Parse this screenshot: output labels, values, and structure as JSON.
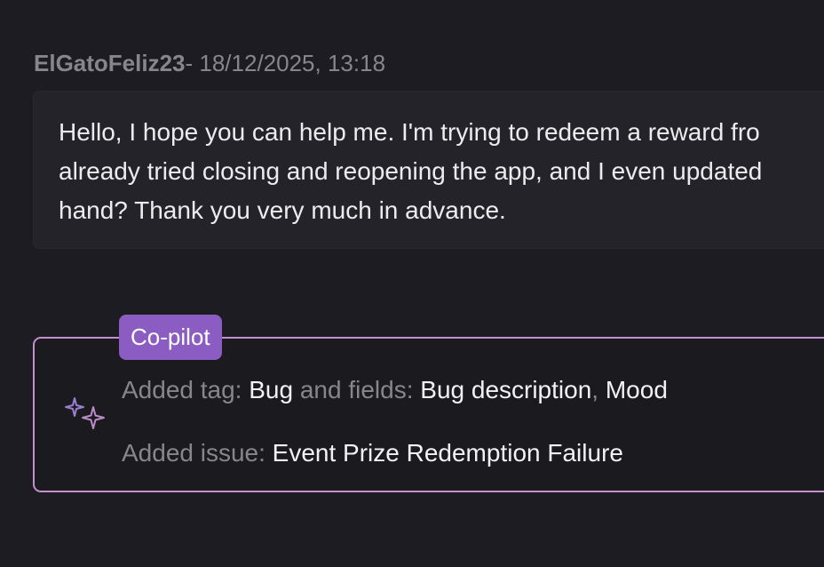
{
  "message": {
    "author": "ElGatoFeliz23",
    "separator": "- ",
    "timestamp": "18/12/2025, 13:18",
    "lines": [
      "Hello, I hope you can help me. I'm trying to redeem a reward fro",
      "already tried closing and reopening the app, and I even updated",
      "hand? Thank you very much in advance."
    ]
  },
  "copilot": {
    "badge_label": "Co-pilot",
    "icon": "sparkle-icon",
    "tag_line": {
      "prefix": "Added tag: ",
      "tag": "Bug",
      "middle": " and fields: ",
      "field_1": "Bug description",
      "comma": ", ",
      "field_2": "Mood"
    },
    "issue_line": {
      "prefix": "Added issue: ",
      "issue": "Event Prize Redemption Failure"
    }
  },
  "colors": {
    "background": "#1c1c22",
    "bubble": "#232329",
    "badge": "#8b5dc3",
    "copilot_border": "#c38fcf"
  }
}
